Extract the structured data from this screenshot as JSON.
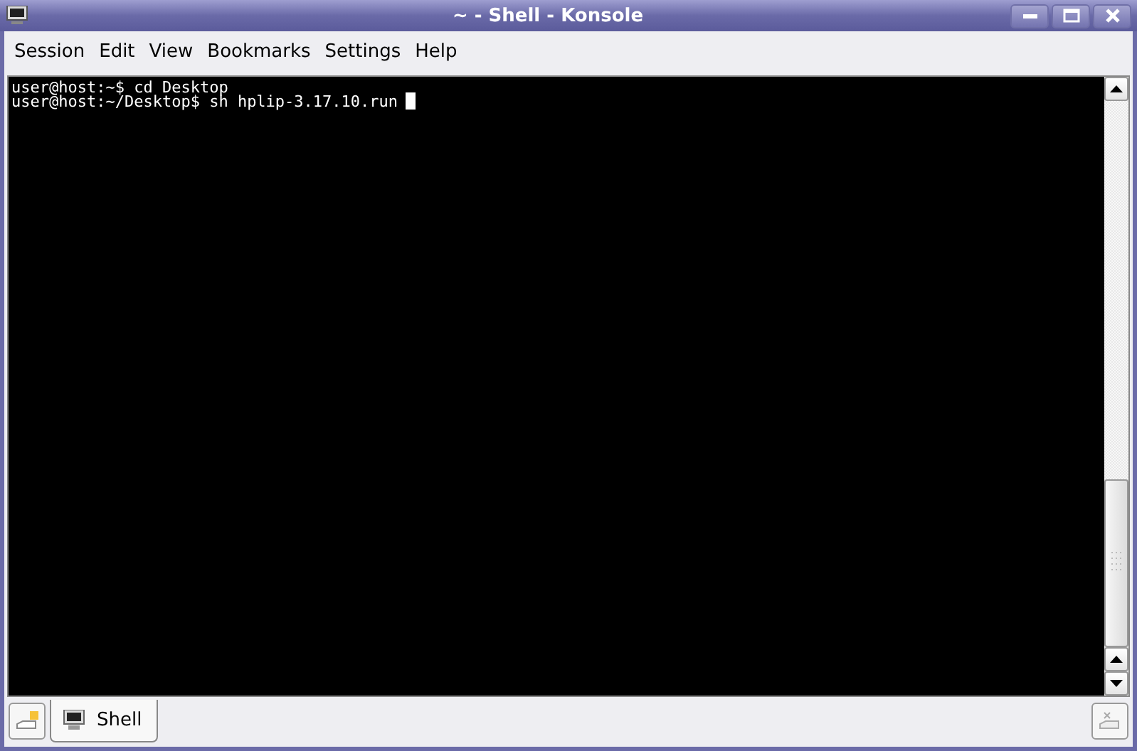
{
  "window": {
    "title": "~ - Shell - Konsole"
  },
  "menu": [
    "Session",
    "Edit",
    "View",
    "Bookmarks",
    "Settings",
    "Help"
  ],
  "terminal": {
    "lines": [
      "user@host:~$ cd Desktop",
      "user@host:~/Desktop$ sh hplip-3.17.10.run"
    ],
    "cursor": true
  },
  "tabs": [
    {
      "label": "Shell",
      "selected": true
    }
  ]
}
